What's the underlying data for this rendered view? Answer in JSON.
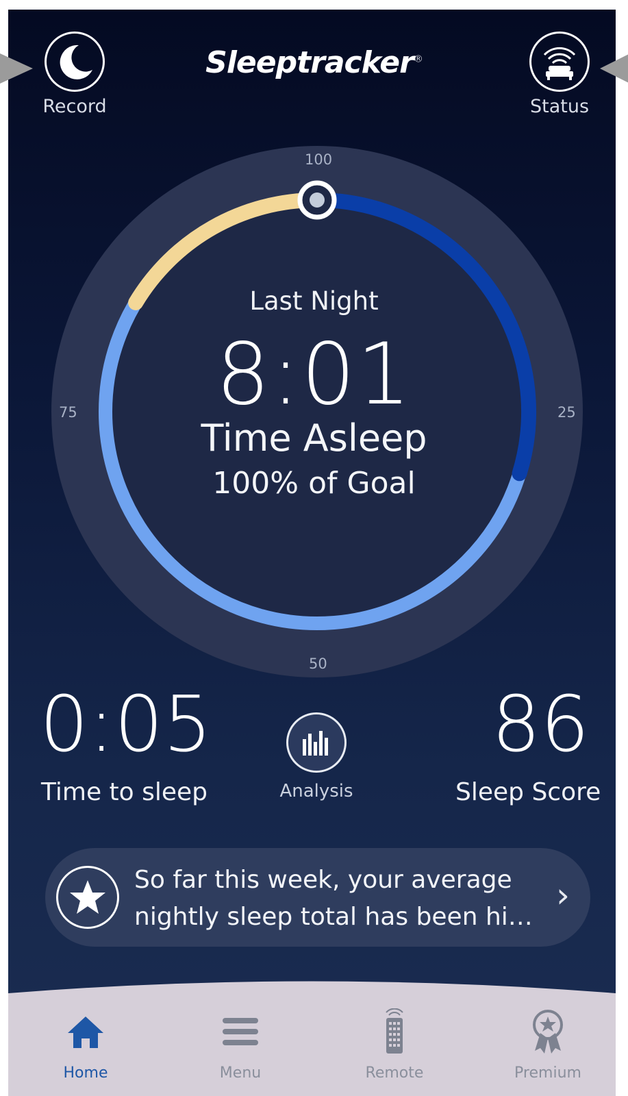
{
  "header": {
    "app_name": "Sleeptracker",
    "logo_trademark": "®",
    "left_button": {
      "label": "Record",
      "icon": "moon-icon"
    },
    "right_button": {
      "label": "Status",
      "icon": "bed-status-icon"
    }
  },
  "dial": {
    "ticks": {
      "top": "100",
      "right": "25",
      "bottom": "50",
      "left": "75"
    },
    "title": "Last Night",
    "time_asleep_value": "8:01",
    "time_asleep_label": "Time Asleep",
    "goal_text": "100% of Goal",
    "goal_percent": 100,
    "colors": {
      "deep": "#0a3ea8",
      "light": "#6fa3f0",
      "awake": "#f3d797",
      "track": "#2c3553"
    }
  },
  "stats": {
    "time_to_sleep": {
      "value": "0:05",
      "label": "Time to sleep"
    },
    "analysis": {
      "label": "Analysis",
      "icon": "bar-chart-icon"
    },
    "sleep_score": {
      "value": "86",
      "label": "Sleep Score"
    }
  },
  "insight": {
    "text_line1": "So far this week, your average",
    "text_line2": "nightly sleep total has been hi…",
    "icon": "star-icon"
  },
  "tabbar": {
    "active_color": "#1e57a6",
    "tabs": [
      {
        "label": "Home",
        "icon": "home-icon",
        "active": true
      },
      {
        "label": "Menu",
        "icon": "menu-icon",
        "active": false
      },
      {
        "label": "Remote",
        "icon": "remote-icon",
        "active": false
      },
      {
        "label": "Premium",
        "icon": "premium-badge-icon",
        "active": false
      }
    ]
  }
}
